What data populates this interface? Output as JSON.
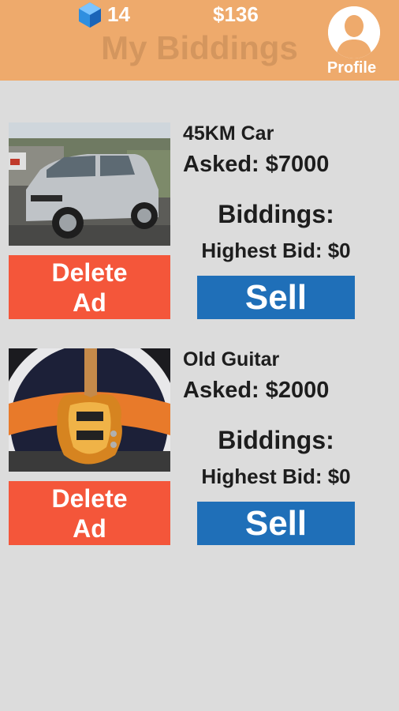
{
  "header": {
    "gem_icon": "blue-gem-icon",
    "gems": "14",
    "money": "$136",
    "title": "My Biddings",
    "profile_label": "Profile",
    "profile_icon": "user-silhouette-icon"
  },
  "colors": {
    "header_bg": "#eeaa6c",
    "title": "#d4965e",
    "background": "#dcdcdc",
    "delete_button": "#f4563a",
    "sell_button": "#1f6fb8"
  },
  "items": [
    {
      "image": "silver-microcar-photo",
      "name": "45KM Car",
      "asked": "Asked: $7000",
      "biddings_label": "Biddings:",
      "highest_bid": "Highest Bid: $0",
      "delete_label": "Delete Ad",
      "sell_label": "Sell"
    },
    {
      "image": "sunburst-electric-guitar-photo",
      "name": "Old Guitar",
      "asked": "Asked: $2000",
      "biddings_label": "Biddings:",
      "highest_bid": "Highest Bid: $0",
      "delete_label": "Delete Ad",
      "sell_label": "Sell"
    }
  ]
}
